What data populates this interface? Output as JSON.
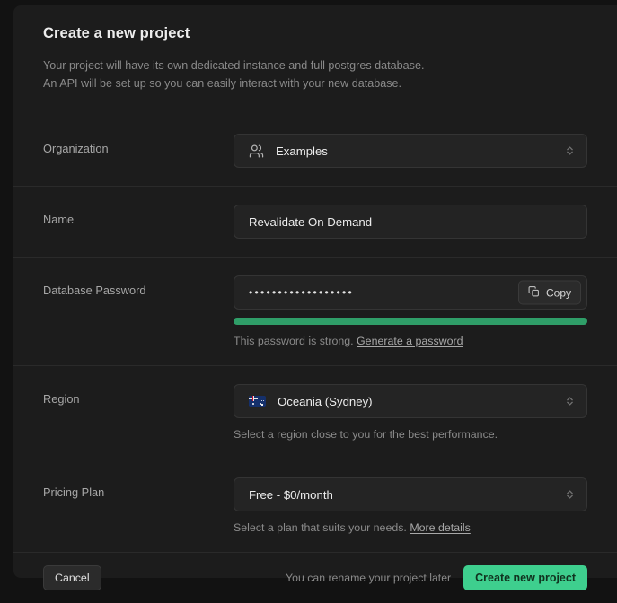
{
  "header": {
    "title": "Create a new project",
    "description_line1": "Your project will have its own dedicated instance and full postgres database.",
    "description_line2": "An API will be set up so you can easily interact with your new database."
  },
  "form": {
    "organization": {
      "label": "Organization",
      "value": "Examples",
      "icon": "users-icon",
      "selector_icon": "chevrons-up-down-icon"
    },
    "name": {
      "label": "Name",
      "value": "Revalidate On Demand",
      "placeholder": "Project name"
    },
    "password": {
      "label": "Database Password",
      "masked_value": "••••••••••••••••••",
      "placeholder": "Type in a strong password",
      "copy_label": "Copy",
      "copy_icon": "copy-icon",
      "strength_text": "This password is strong.",
      "generate_link": "Generate a password",
      "strength_color": "#2f9e68"
    },
    "region": {
      "label": "Region",
      "value": "Oceania (Sydney)",
      "icon": "australia-flag-icon",
      "selector_icon": "chevrons-up-down-icon",
      "hint": "Select a region close to you for the best performance."
    },
    "pricing": {
      "label": "Pricing Plan",
      "value": "Free - $0/month",
      "selector_icon": "chevrons-up-down-icon",
      "hint": "Select a plan that suits your needs.",
      "details_link": "More details"
    }
  },
  "footer": {
    "cancel_label": "Cancel",
    "note": "You can rename your project later",
    "submit_label": "Create new project",
    "accent_color": "#3ecf8e"
  }
}
